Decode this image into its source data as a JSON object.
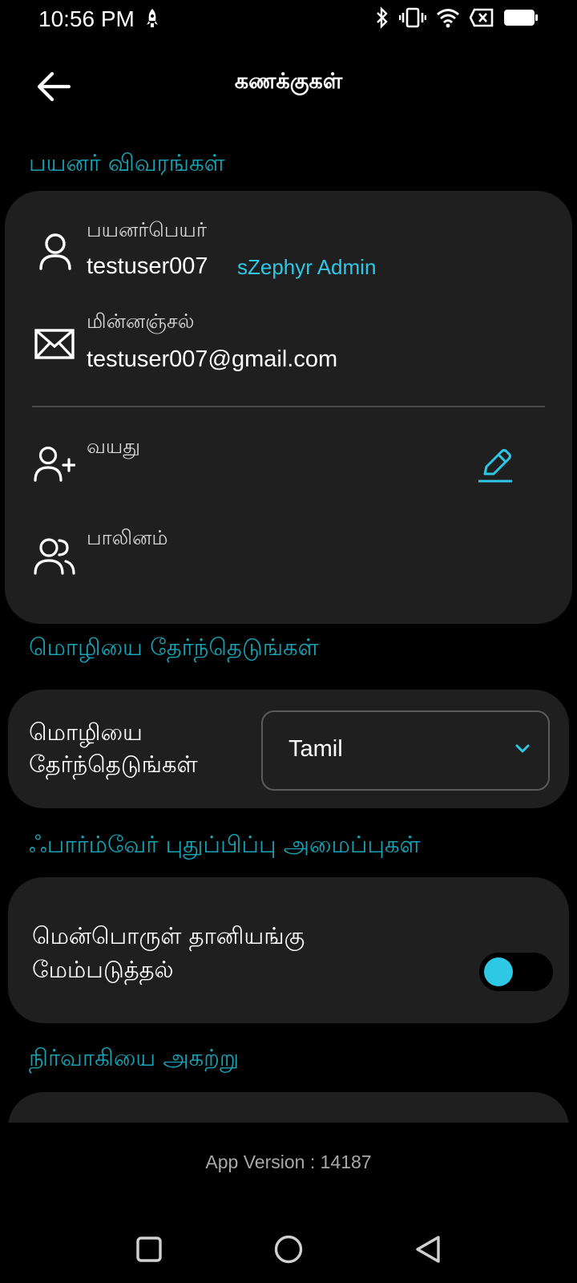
{
  "status_bar": {
    "time": "10:56 PM",
    "icons": [
      "rocket-notification-icon",
      "bluetooth-icon",
      "vibrate-icon",
      "wifi-icon",
      "no-sim-icon",
      "battery-icon"
    ]
  },
  "app_bar": {
    "title": "கணக்குகள்",
    "back_icon": "arrow-left-icon"
  },
  "user_details": {
    "section_title": "பயனர் விவரங்கள்",
    "username": {
      "label": "பயனர்பெயர்",
      "value": "testuser007",
      "badge": "sZephyr Admin",
      "icon": "user-icon"
    },
    "email": {
      "label": "மின்னஞ்சல்",
      "value": "testuser007@gmail.com",
      "icon": "mail-icon"
    },
    "age": {
      "label": "வயது",
      "icon": "user-plus-icon",
      "edit_icon": "pencil-icon"
    },
    "gender": {
      "label": "பாலினம்",
      "icon": "users-icon"
    }
  },
  "language": {
    "section_title": "மொழியை தேர்ந்தெடுங்கள்",
    "label_line1": "மொழியை",
    "label_line2": "தேர்ந்தெடுங்கள்",
    "selected": "Tamil"
  },
  "firmware": {
    "section_title": "ஃபார்ம்வேர் புதுப்பிப்பு அமைப்புகள்",
    "toggle_label_line1": "மென்பொருள் தானியங்கு",
    "toggle_label_line2": "மேம்படுத்தல்",
    "toggle_state": "off"
  },
  "remove_admin": {
    "section_title": "நிர்வாகியை அகற்று"
  },
  "footer": {
    "app_version": "App Version : 14187"
  },
  "nav_bar": {
    "recents": "square-icon",
    "home": "circle-icon",
    "back": "triangle-back-icon"
  },
  "colors": {
    "accent": "#2ec8e6",
    "section_header": "#17a3b6",
    "card_bg": "#1f1f1f",
    "background": "#000000"
  }
}
